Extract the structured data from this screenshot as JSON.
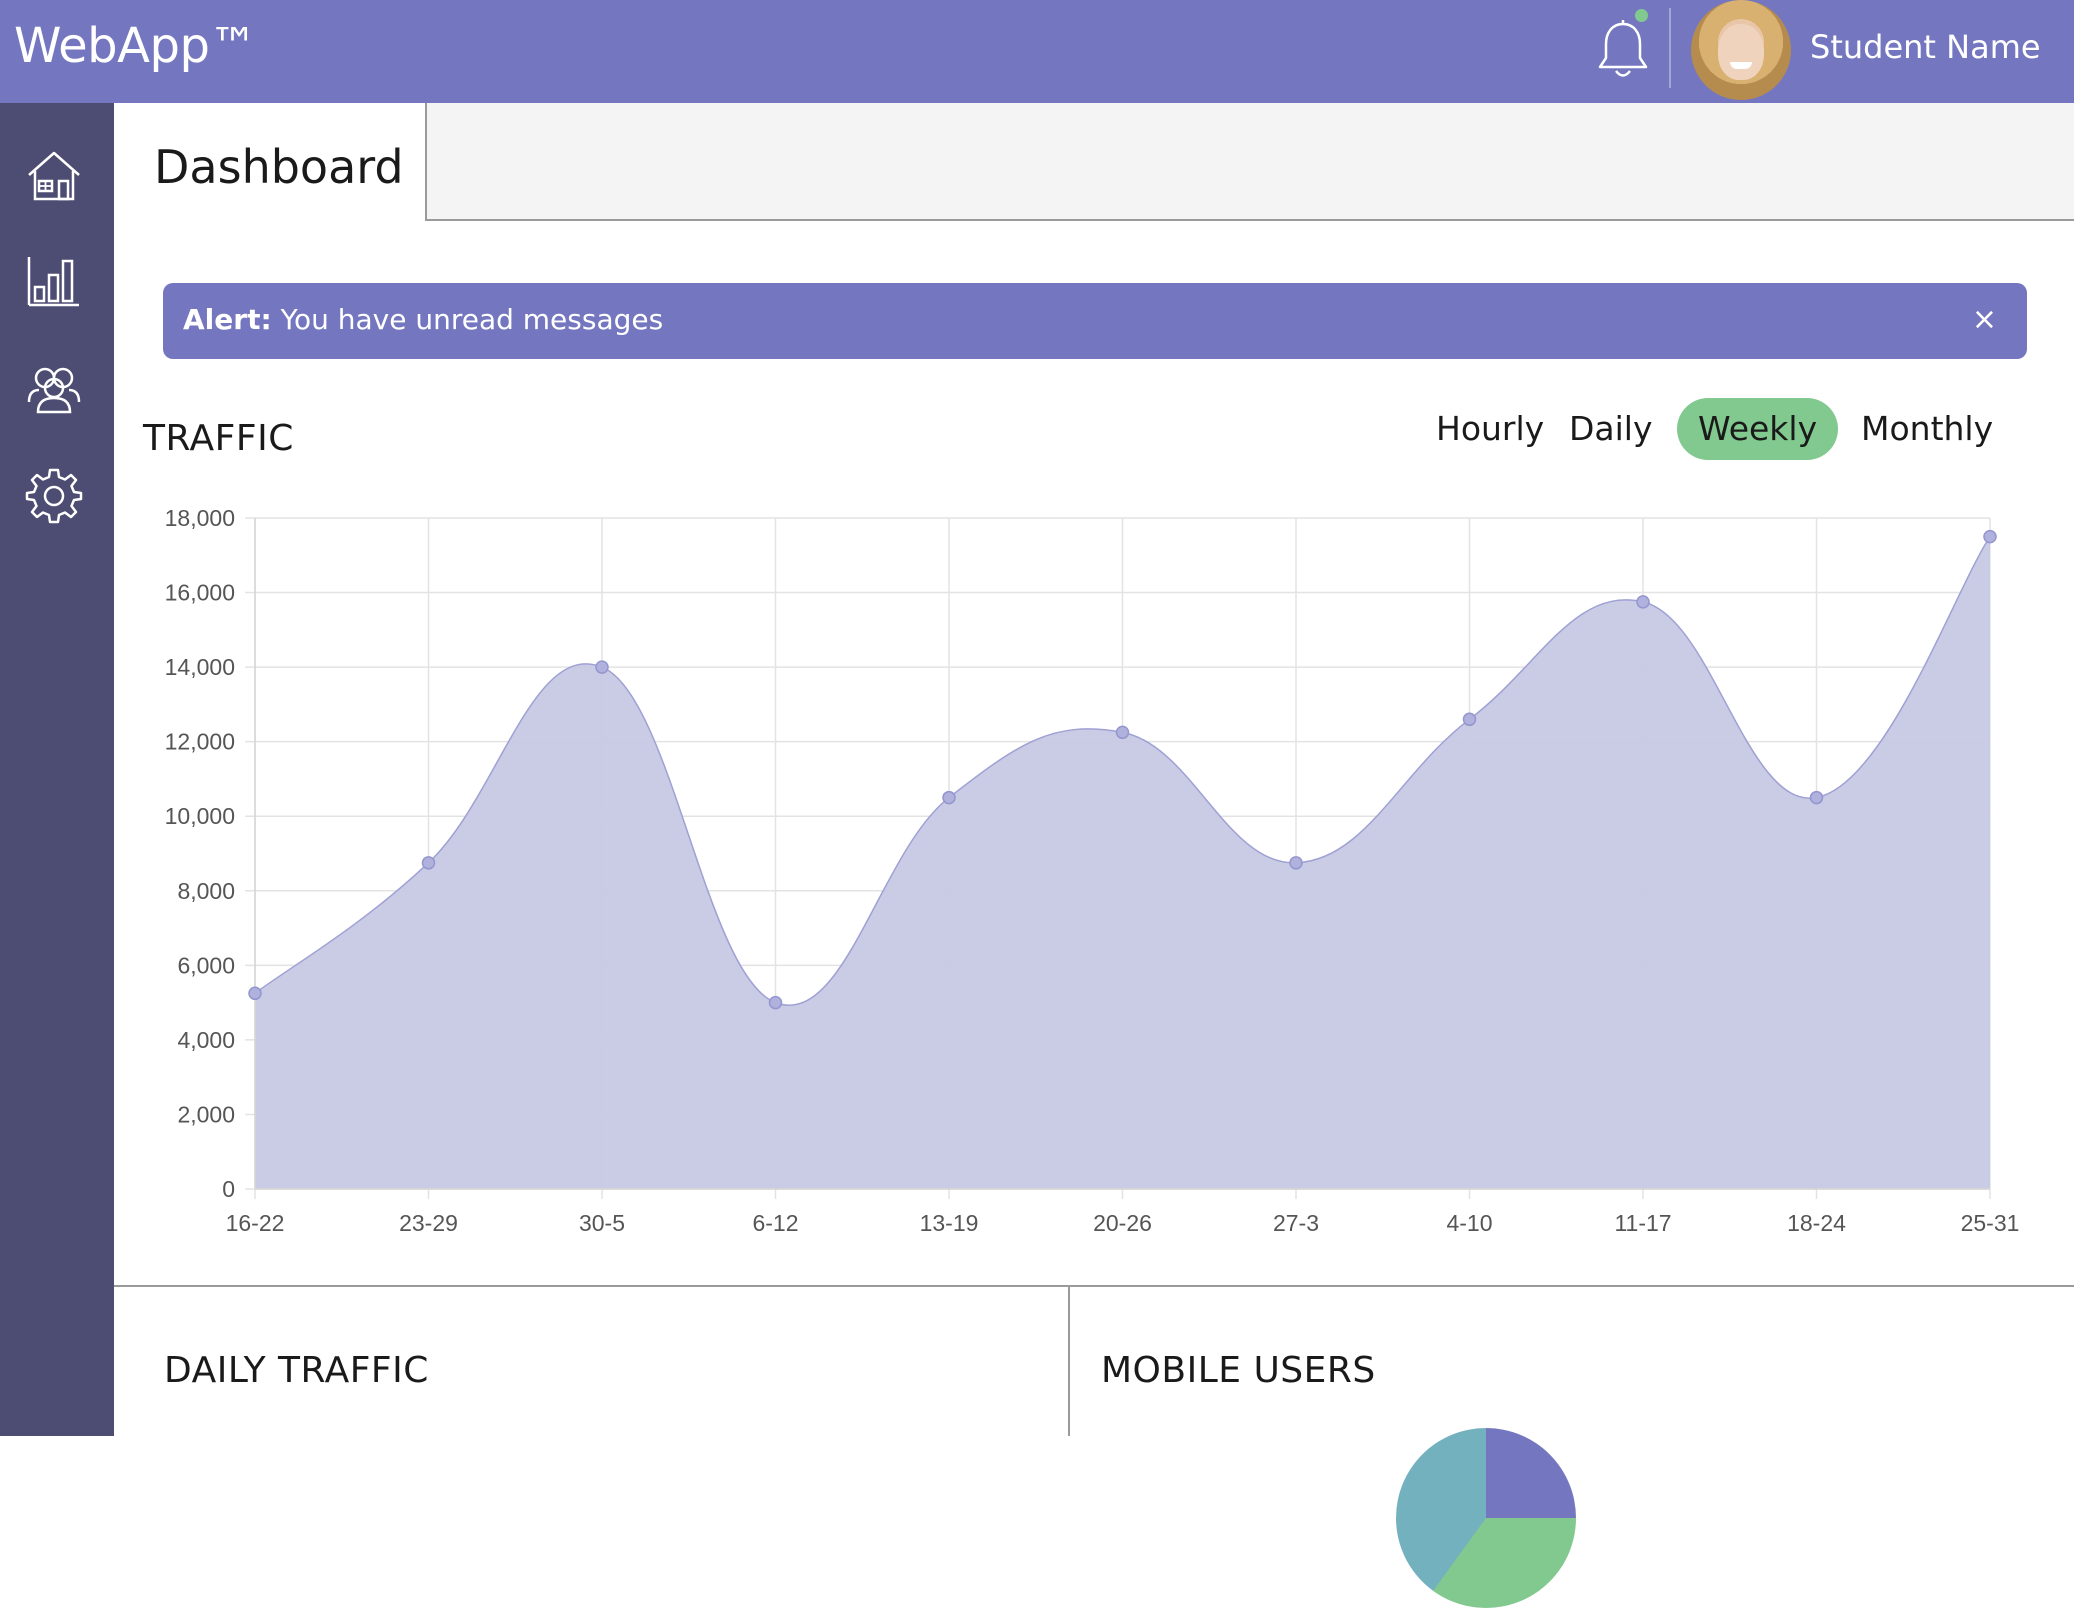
{
  "header": {
    "logo": "WebApp™",
    "user_name": "Student Name",
    "bell_icon": "bell-icon",
    "notification_color": "#81c98f",
    "brand_color": "#7477bf"
  },
  "sidebar": {
    "items": [
      {
        "icon": "home-icon"
      },
      {
        "icon": "bar-chart-icon"
      },
      {
        "icon": "users-icon"
      },
      {
        "icon": "gear-icon"
      }
    ]
  },
  "page": {
    "title": "Dashboard"
  },
  "alert": {
    "label": "Alert:",
    "message": "You have unread messages",
    "close": "×"
  },
  "traffic": {
    "title": "TRAFFIC",
    "filters": [
      "Hourly",
      "Daily",
      "Weekly",
      "Monthly"
    ],
    "active_filter": "Weekly"
  },
  "chart_data": {
    "type": "area",
    "categories": [
      "16-22",
      "23-29",
      "30-5",
      "6-12",
      "13-19",
      "20-26",
      "27-3",
      "4-10",
      "11-17",
      "18-24",
      "25-31"
    ],
    "values": [
      5250,
      8750,
      14000,
      5000,
      10500,
      12250,
      8750,
      12600,
      15750,
      10500,
      17500
    ],
    "ylim": [
      0,
      18000
    ],
    "yticks": [
      "0",
      "2,000",
      "4,000",
      "6,000",
      "8,000",
      "10,000",
      "12,000",
      "14,000",
      "16,000",
      "18,000"
    ],
    "grid": true,
    "fill_color": "#c7c8e4",
    "line_color": "#9fa1d4"
  },
  "daily_traffic": {
    "title": "DAILY TRAFFIC"
  },
  "mobile_users": {
    "title": "MOBILE USERS"
  }
}
